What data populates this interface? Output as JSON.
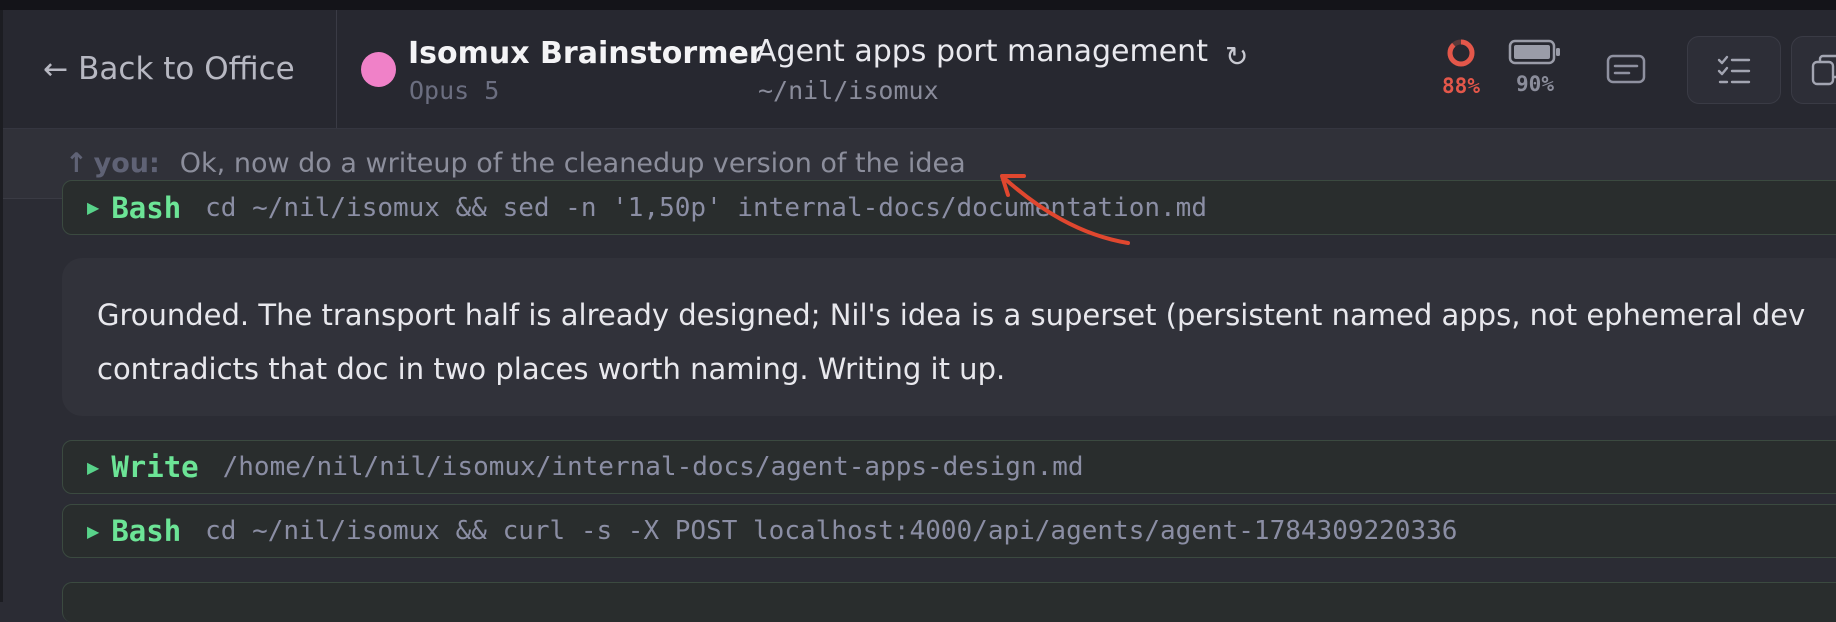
{
  "header": {
    "back_label": "Back to Office",
    "agent": {
      "name": "Isomux Brainstormer",
      "model": "Opus 5",
      "color": "#f081c8"
    },
    "task": {
      "title": "Agent apps port management",
      "path": "~/nil/isomux"
    },
    "context_usage": {
      "label": "88%",
      "value": 0.88,
      "color": "#e4574a"
    },
    "battery": {
      "label": "90%",
      "value": 0.9
    }
  },
  "you_bar": {
    "label": "you:",
    "text": "Ok, now do a writeup of the cleanedup version of the idea"
  },
  "conversation": {
    "tool_calls": [
      {
        "tool": "Bash",
        "command": "cd ~/nil/isomux && sed -n '1,50p' internal-docs/documentation.md"
      },
      {
        "tool": "Write",
        "command": "/home/nil/nil/isomux/internal-docs/agent-apps-design.md"
      },
      {
        "tool": "Bash",
        "command": "cd ~/nil/isomux && curl -s -X POST localhost:4000/api/agents/agent-1784309220336"
      }
    ],
    "message_lines": [
      "Grounded. The transport half is already designed; Nil's idea is a superset (persistent named apps, not ephemeral dev",
      "contradicts that doc in two places worth naming. Writing it up."
    ]
  },
  "icons": {
    "back": "arrow-left-icon",
    "refresh": "refresh-icon",
    "context": "context-ring-icon",
    "battery": "battery-icon",
    "message": "message-icon",
    "todo": "checklist-icon",
    "copy": "copy-icon",
    "expand": "triangle-right-icon",
    "you": "arrow-up-icon"
  },
  "colors": {
    "accent_green": "#6ce496",
    "annotation_red": "#e0472f"
  }
}
